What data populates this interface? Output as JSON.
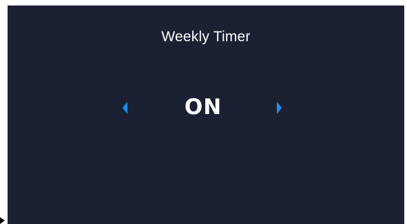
{
  "screen": {
    "title": "Weekly Timer",
    "value": "ON",
    "prev_icon": "chevron-left-icon",
    "next_icon": "chevron-right-icon"
  },
  "colors": {
    "background": "#1b2133",
    "text": "#ffffff",
    "accent": "#1e8ff0"
  }
}
